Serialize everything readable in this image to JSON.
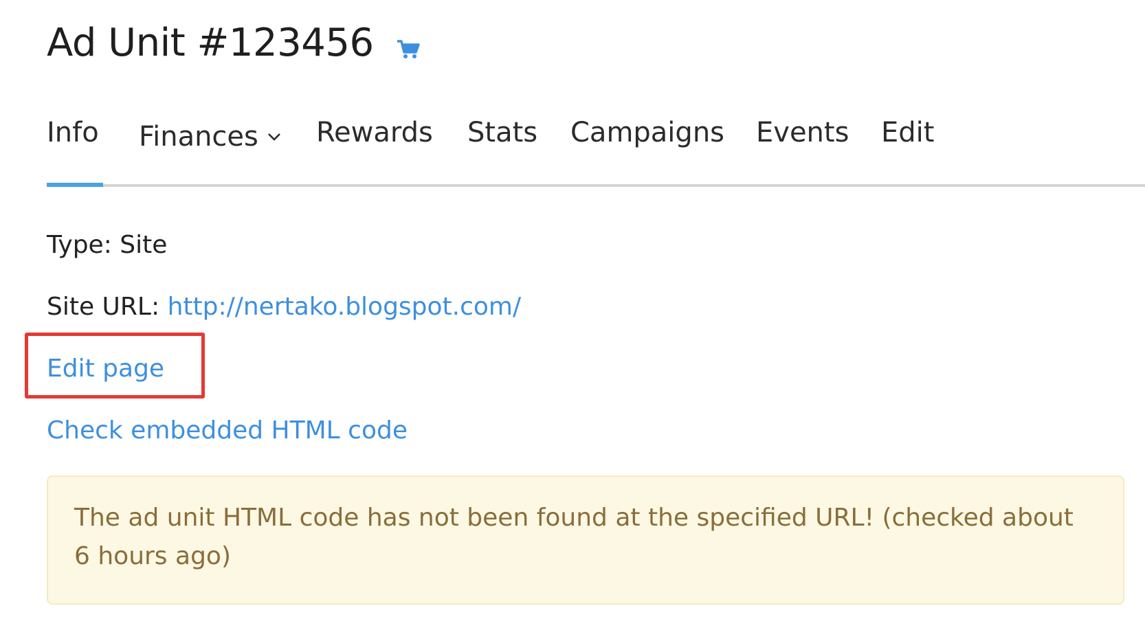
{
  "header": {
    "title": "Ad Unit #123456",
    "title_icon": "shopping-cart-icon",
    "accent_color": "#3d8fe0"
  },
  "tabs": [
    {
      "label": "Info",
      "active": true
    },
    {
      "label": "Finances",
      "has_dropdown": true
    },
    {
      "label": "Rewards"
    },
    {
      "label": "Stats"
    },
    {
      "label": "Campaigns"
    },
    {
      "label": "Events"
    },
    {
      "label": "Edit"
    }
  ],
  "details": {
    "type_label": "Type:",
    "type_value": "Site",
    "site_url_label": "Site URL:",
    "site_url_value": "http://nertako.blogspot.com/"
  },
  "links": {
    "edit_page": "Edit page",
    "check_code": "Check embedded HTML code"
  },
  "alert": {
    "text": "The ad unit HTML code has not been found at the specified URL! (checked about 6 hours ago)",
    "background": "#fcf8e3",
    "text_color": "#8a6d3b"
  },
  "highlight_color": "#e53935"
}
